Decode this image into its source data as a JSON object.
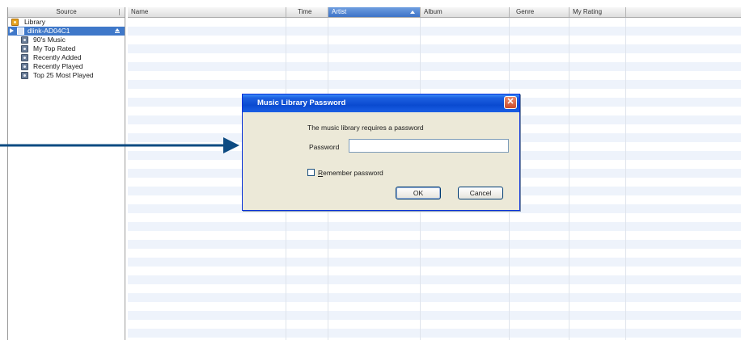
{
  "sidebar": {
    "header": "Source",
    "items": [
      {
        "label": "Library",
        "icon": "library-icon"
      },
      {
        "label": "dlink-AD04C1",
        "icon": "shared-library-icon",
        "selected": true
      },
      {
        "label": "90's Music",
        "icon": "playlist-icon"
      },
      {
        "label": "My Top Rated",
        "icon": "playlist-icon"
      },
      {
        "label": "Recently Added",
        "icon": "playlist-icon"
      },
      {
        "label": "Recently Played",
        "icon": "playlist-icon"
      },
      {
        "label": "Top 25 Most Played",
        "icon": "playlist-icon"
      }
    ]
  },
  "tracklist": {
    "columns": [
      {
        "label": "Name"
      },
      {
        "label": "Time"
      },
      {
        "label": "Artist",
        "sorted": true
      },
      {
        "label": "Album"
      },
      {
        "label": "Genre"
      },
      {
        "label": "My Rating"
      }
    ]
  },
  "dialog": {
    "title": "Music Library Password",
    "close_glyph": "✕",
    "message": "The music library requires a password",
    "password_label": "Password",
    "password_value": "",
    "remember_label": "Remember password",
    "remember_checked": false,
    "ok_label": "OK",
    "cancel_label": "Cancel"
  },
  "colors": {
    "selection": "#3f78c9",
    "arrow": "#0d4b82",
    "dialog_title": "#0a4ad0"
  }
}
